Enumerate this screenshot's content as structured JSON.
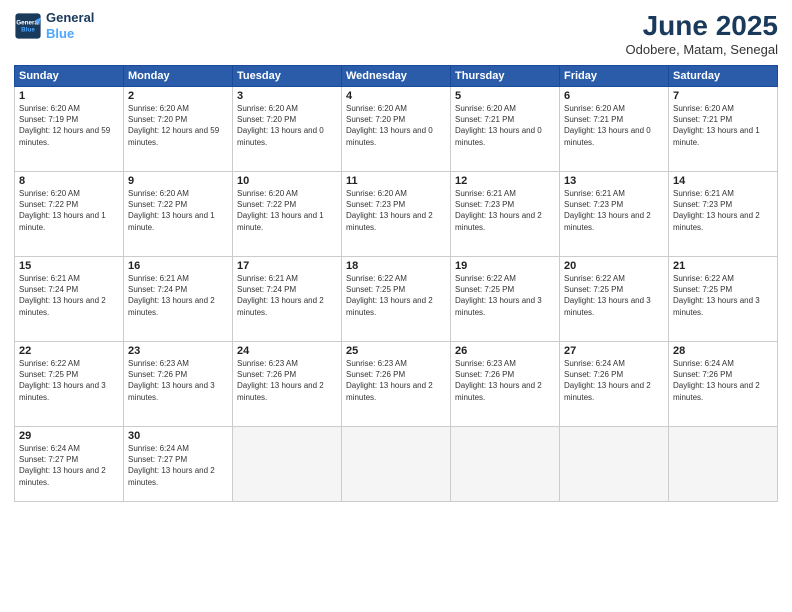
{
  "header": {
    "logo_line1": "General",
    "logo_line2": "Blue",
    "month": "June 2025",
    "location": "Odobere, Matam, Senegal"
  },
  "weekdays": [
    "Sunday",
    "Monday",
    "Tuesday",
    "Wednesday",
    "Thursday",
    "Friday",
    "Saturday"
  ],
  "weeks": [
    [
      {
        "day": "1",
        "detail": "Sunrise: 6:20 AM\nSunset: 7:19 PM\nDaylight: 12 hours and 59 minutes."
      },
      {
        "day": "2",
        "detail": "Sunrise: 6:20 AM\nSunset: 7:20 PM\nDaylight: 12 hours and 59 minutes."
      },
      {
        "day": "3",
        "detail": "Sunrise: 6:20 AM\nSunset: 7:20 PM\nDaylight: 13 hours and 0 minutes."
      },
      {
        "day": "4",
        "detail": "Sunrise: 6:20 AM\nSunset: 7:20 PM\nDaylight: 13 hours and 0 minutes."
      },
      {
        "day": "5",
        "detail": "Sunrise: 6:20 AM\nSunset: 7:21 PM\nDaylight: 13 hours and 0 minutes."
      },
      {
        "day": "6",
        "detail": "Sunrise: 6:20 AM\nSunset: 7:21 PM\nDaylight: 13 hours and 0 minutes."
      },
      {
        "day": "7",
        "detail": "Sunrise: 6:20 AM\nSunset: 7:21 PM\nDaylight: 13 hours and 1 minute."
      }
    ],
    [
      {
        "day": "8",
        "detail": "Sunrise: 6:20 AM\nSunset: 7:22 PM\nDaylight: 13 hours and 1 minute."
      },
      {
        "day": "9",
        "detail": "Sunrise: 6:20 AM\nSunset: 7:22 PM\nDaylight: 13 hours and 1 minute."
      },
      {
        "day": "10",
        "detail": "Sunrise: 6:20 AM\nSunset: 7:22 PM\nDaylight: 13 hours and 1 minute."
      },
      {
        "day": "11",
        "detail": "Sunrise: 6:20 AM\nSunset: 7:23 PM\nDaylight: 13 hours and 2 minutes."
      },
      {
        "day": "12",
        "detail": "Sunrise: 6:21 AM\nSunset: 7:23 PM\nDaylight: 13 hours and 2 minutes."
      },
      {
        "day": "13",
        "detail": "Sunrise: 6:21 AM\nSunset: 7:23 PM\nDaylight: 13 hours and 2 minutes."
      },
      {
        "day": "14",
        "detail": "Sunrise: 6:21 AM\nSunset: 7:23 PM\nDaylight: 13 hours and 2 minutes."
      }
    ],
    [
      {
        "day": "15",
        "detail": "Sunrise: 6:21 AM\nSunset: 7:24 PM\nDaylight: 13 hours and 2 minutes."
      },
      {
        "day": "16",
        "detail": "Sunrise: 6:21 AM\nSunset: 7:24 PM\nDaylight: 13 hours and 2 minutes."
      },
      {
        "day": "17",
        "detail": "Sunrise: 6:21 AM\nSunset: 7:24 PM\nDaylight: 13 hours and 2 minutes."
      },
      {
        "day": "18",
        "detail": "Sunrise: 6:22 AM\nSunset: 7:25 PM\nDaylight: 13 hours and 2 minutes."
      },
      {
        "day": "19",
        "detail": "Sunrise: 6:22 AM\nSunset: 7:25 PM\nDaylight: 13 hours and 3 minutes."
      },
      {
        "day": "20",
        "detail": "Sunrise: 6:22 AM\nSunset: 7:25 PM\nDaylight: 13 hours and 3 minutes."
      },
      {
        "day": "21",
        "detail": "Sunrise: 6:22 AM\nSunset: 7:25 PM\nDaylight: 13 hours and 3 minutes."
      }
    ],
    [
      {
        "day": "22",
        "detail": "Sunrise: 6:22 AM\nSunset: 7:25 PM\nDaylight: 13 hours and 3 minutes."
      },
      {
        "day": "23",
        "detail": "Sunrise: 6:23 AM\nSunset: 7:26 PM\nDaylight: 13 hours and 3 minutes."
      },
      {
        "day": "24",
        "detail": "Sunrise: 6:23 AM\nSunset: 7:26 PM\nDaylight: 13 hours and 2 minutes."
      },
      {
        "day": "25",
        "detail": "Sunrise: 6:23 AM\nSunset: 7:26 PM\nDaylight: 13 hours and 2 minutes."
      },
      {
        "day": "26",
        "detail": "Sunrise: 6:23 AM\nSunset: 7:26 PM\nDaylight: 13 hours and 2 minutes."
      },
      {
        "day": "27",
        "detail": "Sunrise: 6:24 AM\nSunset: 7:26 PM\nDaylight: 13 hours and 2 minutes."
      },
      {
        "day": "28",
        "detail": "Sunrise: 6:24 AM\nSunset: 7:26 PM\nDaylight: 13 hours and 2 minutes."
      }
    ],
    [
      {
        "day": "29",
        "detail": "Sunrise: 6:24 AM\nSunset: 7:27 PM\nDaylight: 13 hours and 2 minutes."
      },
      {
        "day": "30",
        "detail": "Sunrise: 6:24 AM\nSunset: 7:27 PM\nDaylight: 13 hours and 2 minutes."
      },
      null,
      null,
      null,
      null,
      null
    ]
  ]
}
